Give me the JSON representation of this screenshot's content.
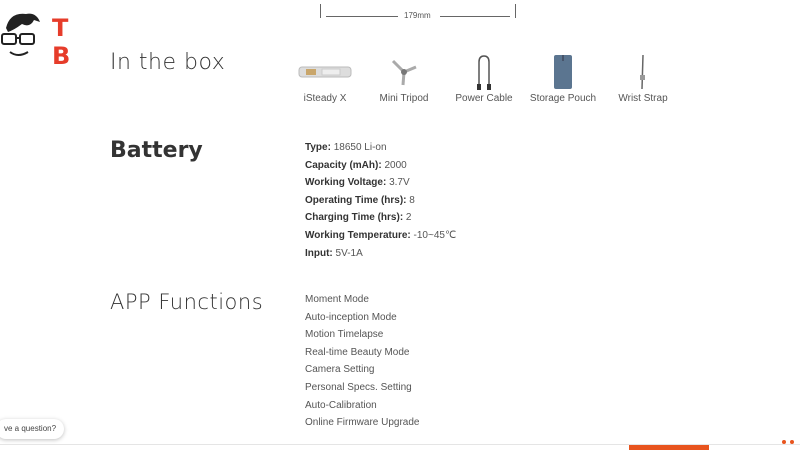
{
  "logo": {
    "letters": [
      "T",
      "B"
    ],
    "colors": {
      "accent": "#e63c2a"
    }
  },
  "dimension": {
    "label": "179mm"
  },
  "sections": {
    "in_the_box": {
      "title": "In the box"
    },
    "battery": {
      "title": "Battery"
    },
    "app_functions": {
      "title": "APP Functions"
    }
  },
  "box_items": [
    {
      "label": "iSteady X",
      "icon": "gimbal-icon"
    },
    {
      "label": "Mini Tripod",
      "icon": "tripod-icon"
    },
    {
      "label": "Power Cable",
      "icon": "cable-icon"
    },
    {
      "label": "Storage Pouch",
      "icon": "pouch-icon"
    },
    {
      "label": "Wrist Strap",
      "icon": "strap-icon"
    }
  ],
  "battery_specs": [
    {
      "key": "Type:",
      "value": " 18650 Li-on"
    },
    {
      "key": "Capacity (mAh):",
      "value": " 2000"
    },
    {
      "key": "Working Voltage:",
      "value": " 3.7V"
    },
    {
      "key": "Operating Time (hrs):",
      "value": " 8"
    },
    {
      "key": "Charging Time (hrs):",
      "value": " 2"
    },
    {
      "key": "Working Temperature:",
      "value": " -10~45℃"
    },
    {
      "key": "Input:",
      "value": " 5V-1A"
    }
  ],
  "app_functions": [
    "Moment Mode",
    "Auto-inception Mode",
    "Motion Timelapse",
    "Real-time Beauty Mode",
    "Camera Setting",
    "Personal Specs. Setting",
    "Auto-Calibration",
    "Online Firmware Upgrade"
  ],
  "chat": {
    "label": "ve a question?"
  },
  "colors": {
    "orange": "#e8541e"
  }
}
